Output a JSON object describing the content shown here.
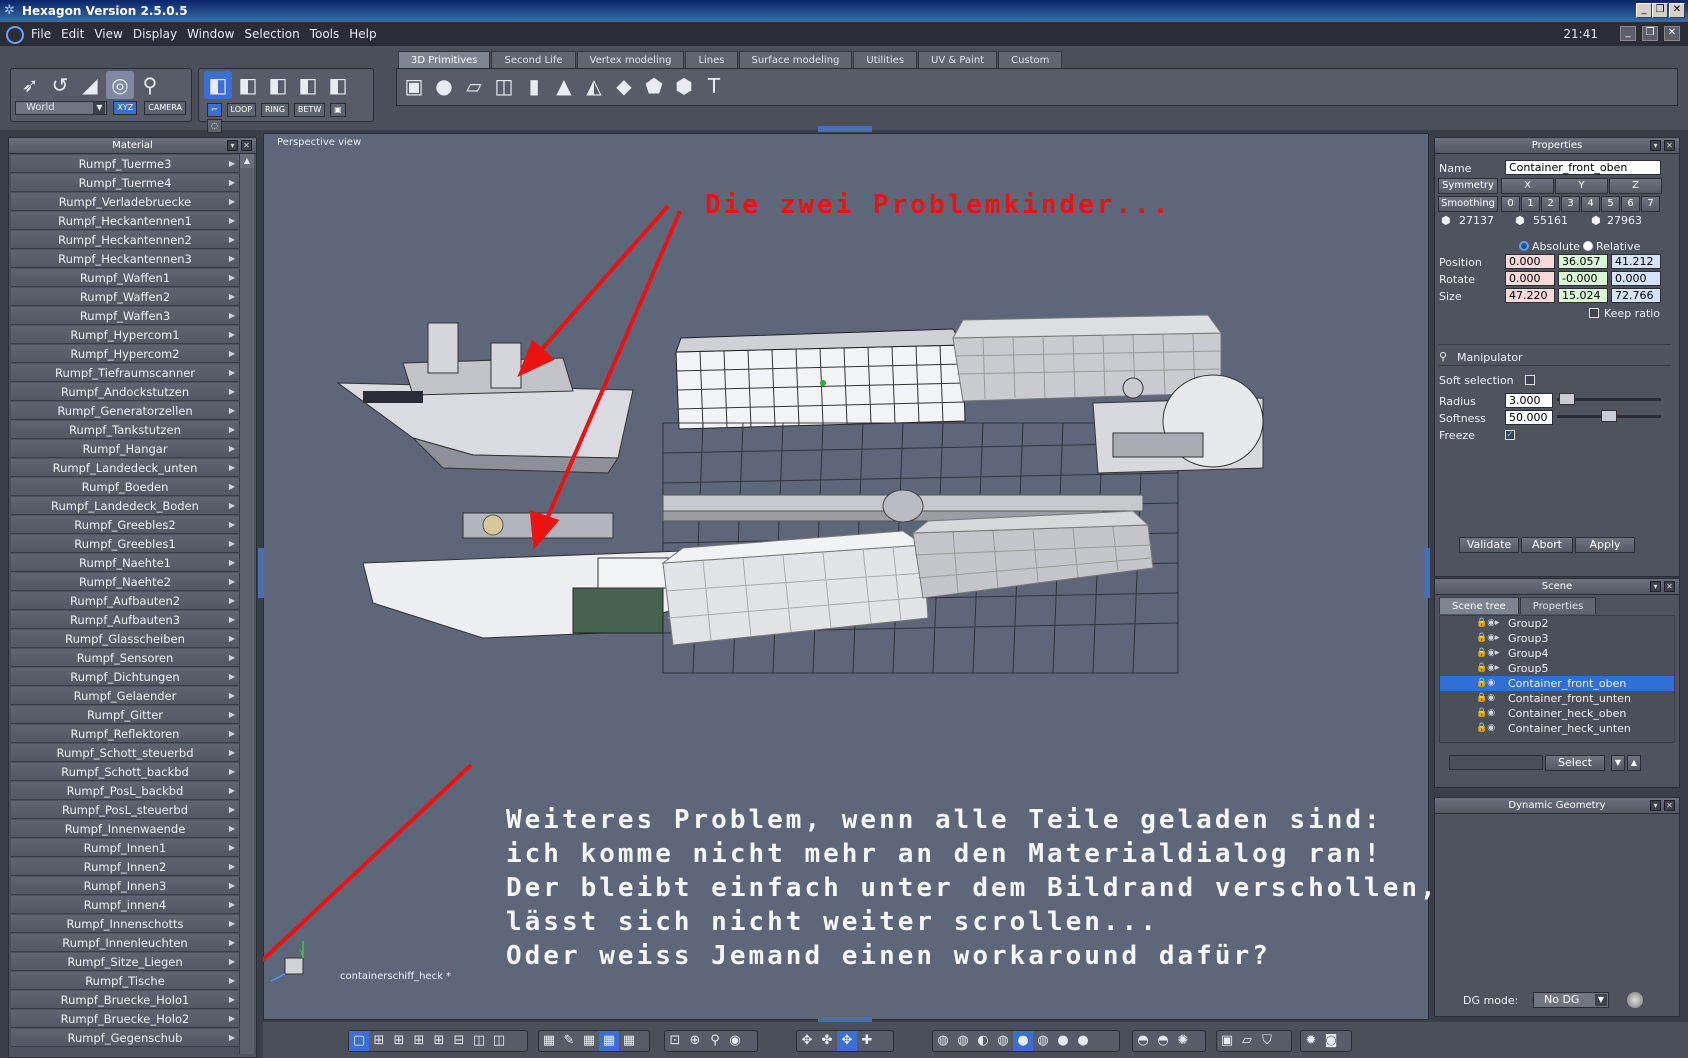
{
  "app": {
    "title": "Hexagon Version 2.5.0.5",
    "clock": "21:41"
  },
  "menu": [
    "File",
    "Edit",
    "View",
    "Display",
    "Window",
    "Selection",
    "Tools",
    "Help"
  ],
  "toolbar": {
    "coord_select": "World",
    "xyz_label": "XYZ",
    "camera_label": "CAMERA",
    "select_modes": [
      "LOOP",
      "RING",
      "BETW"
    ],
    "tabs": [
      "3D Primitives",
      "Second Life",
      "Vertex modeling",
      "Lines",
      "Surface modeling",
      "Utilities",
      "UV & Paint",
      "Custom"
    ],
    "active_tab": "3D Primitives"
  },
  "material_panel": {
    "title": "Material",
    "items": [
      "Rumpf_Tuerme3",
      "Rumpf_Tuerme4",
      "Rumpf_Verladebruecke",
      "Rumpf_Heckantennen1",
      "Rumpf_Heckantennen2",
      "Rumpf_Heckantennen3",
      "Rumpf_Waffen1",
      "Rumpf_Waffen2",
      "Rumpf_Waffen3",
      "Rumpf_Hypercom1",
      "Rumpf_Hypercom2",
      "Rumpf_Tiefraumscanner",
      "Rumpf_Andockstutzen",
      "Rumpf_Generatorzellen",
      "Rumpf_Tankstutzen",
      "Rumpf_Hangar",
      "Rumpf_Landedeck_unten",
      "Rumpf_Boeden",
      "Rumpf_Landedeck_Boden",
      "Rumpf_Greebles2",
      "Rumpf_Greebles1",
      "Rumpf_Naehte1",
      "Rumpf_Naehte2",
      "Rumpf_Aufbauten2",
      "Rumpf_Aufbauten3",
      "Rumpf_Glasscheiben",
      "Rumpf_Sensoren",
      "Rumpf_Dichtungen",
      "Rumpf_Gelaender",
      "Rumpf_Gitter",
      "Rumpf_Reflektoren",
      "Rumpf_Schott_steuerbd",
      "Rumpf_Schott_backbd",
      "Rumpf_PosL_backbd",
      "Rumpf_PosL_steuerbd",
      "Rumpf_Innenwaende",
      "Rumpf_Innen1",
      "Rumpf_Innen2",
      "Rumpf_Innen3",
      "Rumpf_innen4",
      "Rumpf_Innenschotts",
      "Rumpf_Innenleuchten",
      "Rumpf_Sitze_Liegen",
      "Rumpf_Tische",
      "Rumpf_Bruecke_Holo1",
      "Rumpf_Bruecke_Holo2",
      "Rumpf_Gegenschub"
    ]
  },
  "viewport": {
    "label": "Perspective view",
    "scene_file": "containerschiff_heck *",
    "annotation_title": "Die zwei Problemkinder...",
    "annotation_lines": [
      "Weiteres Problem, wenn alle Teile geladen sind:",
      "ich komme nicht mehr an den Materialdialog ran!",
      "Der bleibt einfach unter dem Bildrand verschollen,",
      "lässt sich nicht weiter scrollen...",
      "Oder weiss Jemand einen workaround dafür?"
    ]
  },
  "properties": {
    "title": "Properties",
    "name_label": "Name",
    "name_value": "Container_front_oben",
    "symmetry_label": "Symmetry",
    "axes": [
      "X",
      "Y",
      "Z"
    ],
    "smoothing_label": "Smoothing",
    "smoothing_levels": [
      "0",
      "1",
      "2",
      "3",
      "4",
      "5",
      "6",
      "7"
    ],
    "counts": [
      "27137",
      "55161",
      "27963"
    ],
    "absolute_label": "Absolute",
    "relative_label": "Relative",
    "position_label": "Position",
    "position": [
      "0.000",
      "36.057",
      "41.212"
    ],
    "rotate_label": "Rotate",
    "rotate": [
      "0.000",
      "-0.000",
      "0.000"
    ],
    "size_label": "Size",
    "size": [
      "47.220",
      "15.024",
      "72.766"
    ],
    "keep_ratio_label": "Keep ratio",
    "manipulator_label": "Manipulator",
    "soft_selection_label": "Soft selection",
    "radius_label": "Radius",
    "radius": "3.000",
    "softness_label": "Softness",
    "softness": "50.000",
    "freeze_label": "Freeze",
    "validate": "Validate",
    "abort": "Abort",
    "apply": "Apply"
  },
  "scene": {
    "title": "Scene",
    "tabs": [
      "Scene tree",
      "Properties"
    ],
    "items": [
      "Group2",
      "Group3",
      "Group4",
      "Group5",
      "Container_front_oben",
      "Container_front_unten",
      "Container_heck_oben",
      "Container_heck_unten"
    ],
    "selected": "Container_front_oben",
    "select_button": "Select"
  },
  "dynamic_geometry": {
    "title": "Dynamic Geometry",
    "dg_mode_label": "DG mode:",
    "dg_mode_value": "No DG"
  },
  "colors": {
    "annotation_red": "#ee1111",
    "selection_blue": "#2f6fd6",
    "viewport_bg": "#5e6779"
  }
}
